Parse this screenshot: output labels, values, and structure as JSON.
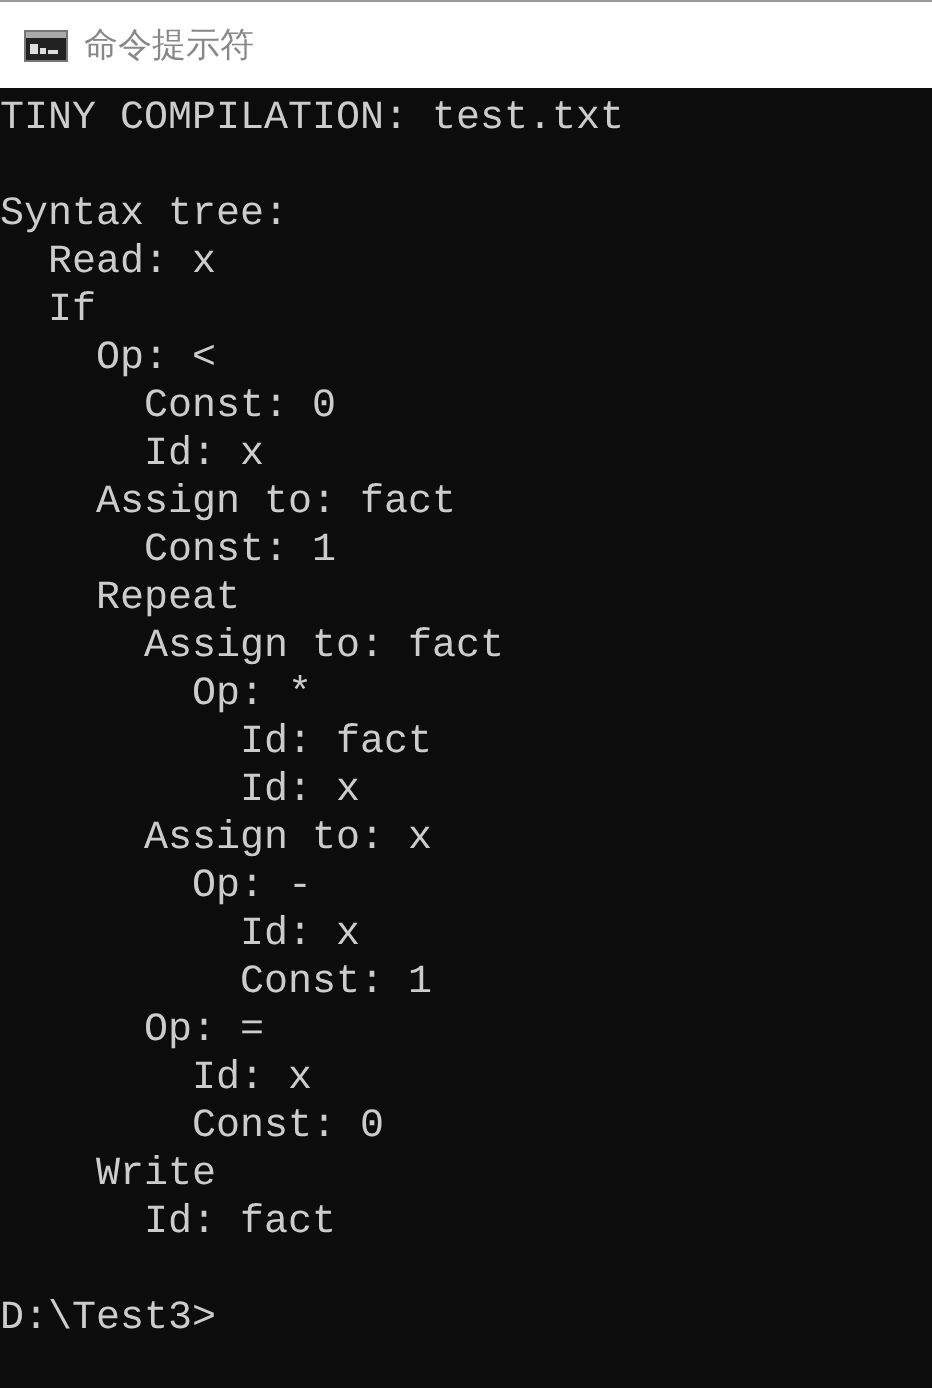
{
  "window": {
    "title": "命令提示符"
  },
  "console": {
    "header": "TINY COMPILATION: test.txt",
    "tree_title": "Syntax tree:",
    "tree": [
      {
        "text": "Read: x"
      },
      {
        "text": "If",
        "children": [
          {
            "text": "Op: <",
            "children": [
              {
                "text": "Const: 0"
              },
              {
                "text": "Id: x"
              }
            ]
          },
          {
            "text": "Assign to: fact",
            "children": [
              {
                "text": "Const: 1"
              }
            ]
          },
          {
            "text": "Repeat",
            "children": [
              {
                "text": "Assign to: fact",
                "children": [
                  {
                    "text": "Op: *",
                    "children": [
                      {
                        "text": "Id: fact"
                      },
                      {
                        "text": "Id: x"
                      }
                    ]
                  }
                ]
              },
              {
                "text": "Assign to: x",
                "children": [
                  {
                    "text": "Op: -",
                    "children": [
                      {
                        "text": "Id: x"
                      },
                      {
                        "text": "Const: 1"
                      }
                    ]
                  }
                ]
              },
              {
                "text": "Op: =",
                "children": [
                  {
                    "text": "Id: x"
                  },
                  {
                    "text": "Const: 0"
                  }
                ]
              }
            ]
          },
          {
            "text": "Write",
            "children": [
              {
                "text": "Id: fact"
              }
            ]
          }
        ]
      }
    ],
    "prompt": "D:\\Test3>"
  }
}
